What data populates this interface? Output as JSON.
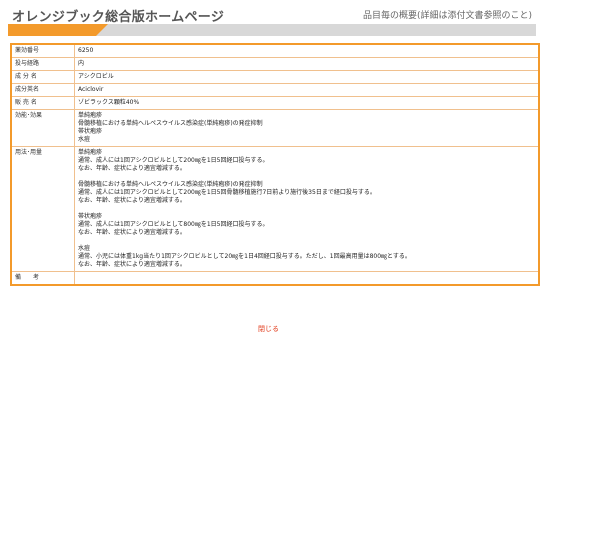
{
  "header": {
    "title": "オレンジブック総合版ホームページ",
    "subtitle": "品目毎の概要(詳細は添付文書参照のこと)"
  },
  "rows": [
    {
      "key": "薬効番号",
      "value": "6250"
    },
    {
      "key": "投与経路",
      "value": "内"
    },
    {
      "key": "成 分 名",
      "value": "アシクロビル"
    },
    {
      "key": "成分英名",
      "value": "Aciclovir"
    },
    {
      "key": "販 売 名",
      "value": "ゾビラックス顆粒40%"
    },
    {
      "key": "効能･効果",
      "value": "単純疱疹\n骨髄移植における単純ヘルペスウイルス感染症(単純疱疹)の発症抑制\n帯状疱疹\n水痘"
    },
    {
      "key": "用法･用量",
      "value": "単純疱疹\n通常、成人には1回アシクロビルとして200㎎を1日5回経口投与する。\nなお、年齢、症状により適宜増減する。\n\n骨髄移植における単純ヘルペスウイルス感染症(単純疱疹)の発症抑制\n通常、成人には1回アシクロビルとして200㎎を1日5回骨髄移植施行7日前より施行後35日まで経口投与する。\nなお、年齢、症状により適宜増減する。\n\n帯状疱疹\n通常、成人には1回アシクロビルとして800㎎を1日5回経口投与する。\nなお、年齢、症状により適宜増減する。\n\n水痘\n通常、小児には体重1kg当たり1回アシクロビルとして20㎎を1日4回経口投与する。ただし、1回最高用量は800㎎とする。\nなお、年齢、症状により適宜増減する。"
    },
    {
      "key": "備　　考",
      "value": ""
    }
  ],
  "close_label": "閉じる"
}
